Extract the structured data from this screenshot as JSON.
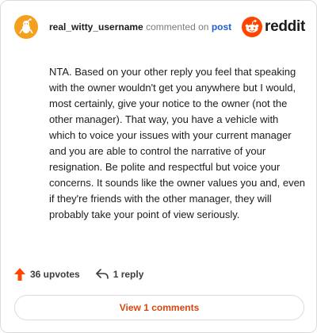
{
  "header": {
    "username": "real_witty_username",
    "commented_text": "commented on",
    "post_link": "post",
    "brand": "reddit",
    "avatar_icon": "reddit-snoo-avatar-icon",
    "brand_icon": "reddit-logo-icon"
  },
  "comment": {
    "text": "NTA. Based on your other reply you feel that speaking with the owner wouldn't get you anywhere but I would, most certainly, give your notice to the owner (not the other manager). That way, you have a vehicle with which to voice your issues with your current manager and you are able to control the narrative of your resignation. Be polite and respectful but voice your concerns. It sounds like the owner values you and, even if they're friends with the other manager, they will probably take your point of view seriously."
  },
  "actions": {
    "upvotes": "36 upvotes",
    "replies": "1 reply",
    "view_comments": "View 1 comments"
  },
  "colors": {
    "avatar_bg": "#f4a01e",
    "reddit_orange": "#ff4500",
    "link_blue": "#1f5fd1",
    "view_button_text": "#d6470e"
  }
}
